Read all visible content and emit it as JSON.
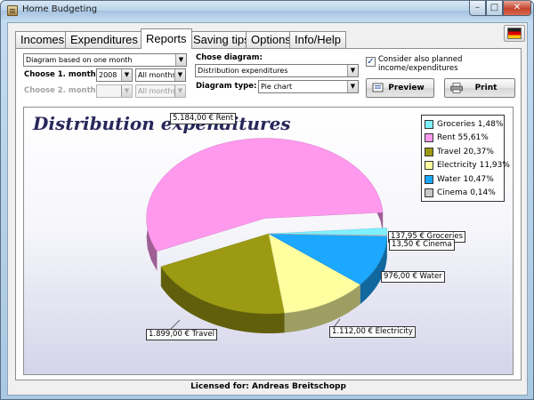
{
  "window": {
    "title": "Home Budgeting",
    "controls": {
      "minimize": "–",
      "maximize": "□",
      "close": "✕"
    }
  },
  "tabs": [
    {
      "label": "Incomes",
      "active": false
    },
    {
      "label": "Expenditures",
      "active": false
    },
    {
      "label": "Reports",
      "active": true
    },
    {
      "label": "Saving tips",
      "active": false
    },
    {
      "label": "Options",
      "active": false
    },
    {
      "label": "Info/Help",
      "active": false
    }
  ],
  "language_flag": "german-flag-icon",
  "report_form": {
    "mode_value": "Diagram based on one month",
    "month1_label": "Choose 1. month:",
    "month1_year": "2008",
    "month1_month": "All months",
    "month2_label": "Choose 2. month:",
    "month2_year": "",
    "month2_month": "All months",
    "diagram_label": "Chose diagram:",
    "diagram_value": "Distribution expenditures",
    "type_label": "Diagram type:",
    "type_value": "Pie chart",
    "planned_checked": true,
    "planned_label": "Consider also planned income/expenditures",
    "preview_label": "Preview",
    "print_label": "Print"
  },
  "chart_data": {
    "type": "pie",
    "title": "Distribution expenditures",
    "categories": [
      "Groceries",
      "Rent",
      "Travel",
      "Electricity",
      "Water",
      "Cinema"
    ],
    "values": [
      137.95,
      5184.0,
      1899.0,
      1112.0,
      976.0,
      13.5
    ],
    "percent_labels": [
      "1,48%",
      "55,61%",
      "20,37%",
      "11,93%",
      "10,47%",
      "0,14%"
    ],
    "value_labels": [
      "137,95 € Groceries",
      "5.184,00 € Rent",
      "1.899,00 € Travel",
      "1.112,00 € Electricity",
      "976,00 € Water",
      "13,50 € Cinema"
    ],
    "colors": [
      "#7ff0ff",
      "#ff99ee",
      "#9c9a12",
      "#ffffa0",
      "#1ca8ff",
      "#c8c8c8"
    ],
    "exploded": "Rent",
    "legend_position": "top-right"
  },
  "status_text": "Licensed for: Andreas Breitschopp"
}
